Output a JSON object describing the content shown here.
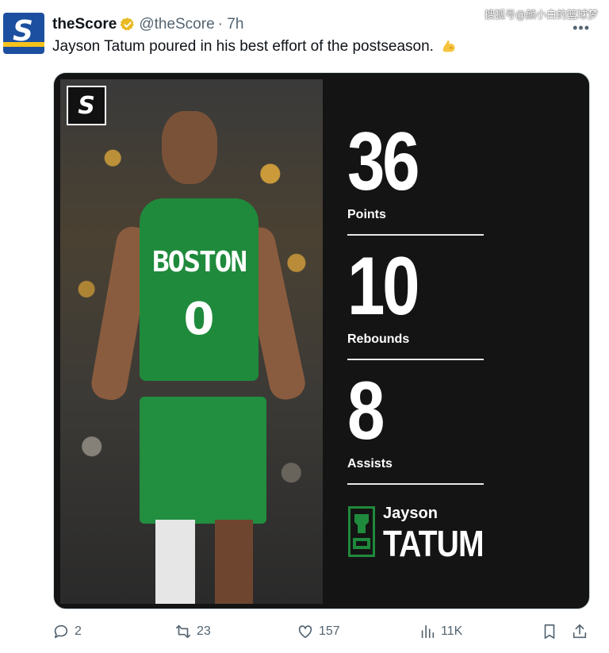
{
  "watermark": "搜狐号@颜小白的篮球梦",
  "author": {
    "name": "theScore",
    "handle": "@theScore",
    "time": "· 7h",
    "avatar_letter": "S"
  },
  "tweet": {
    "text": "Jayson Tatum poured in his best effort of the postseason."
  },
  "media": {
    "logo_letter": "S",
    "jersey_text": "BOSTON",
    "jersey_number": "0",
    "stats": [
      {
        "value": "36",
        "label": "Points"
      },
      {
        "value": "10",
        "label": "Rebounds"
      },
      {
        "value": "8",
        "label": "Assists"
      }
    ],
    "player_first": "Jayson",
    "player_last": "TATUM"
  },
  "actions": {
    "reply_count": "2",
    "retweet_count": "23",
    "like_count": "157",
    "views_count": "11K"
  },
  "colors": {
    "brand_blue": "#1c4fa0",
    "brand_yellow": "#f6c21b",
    "celtics_green": "#1f8a3c",
    "card_bg": "#141414",
    "muted_text": "#536471"
  }
}
